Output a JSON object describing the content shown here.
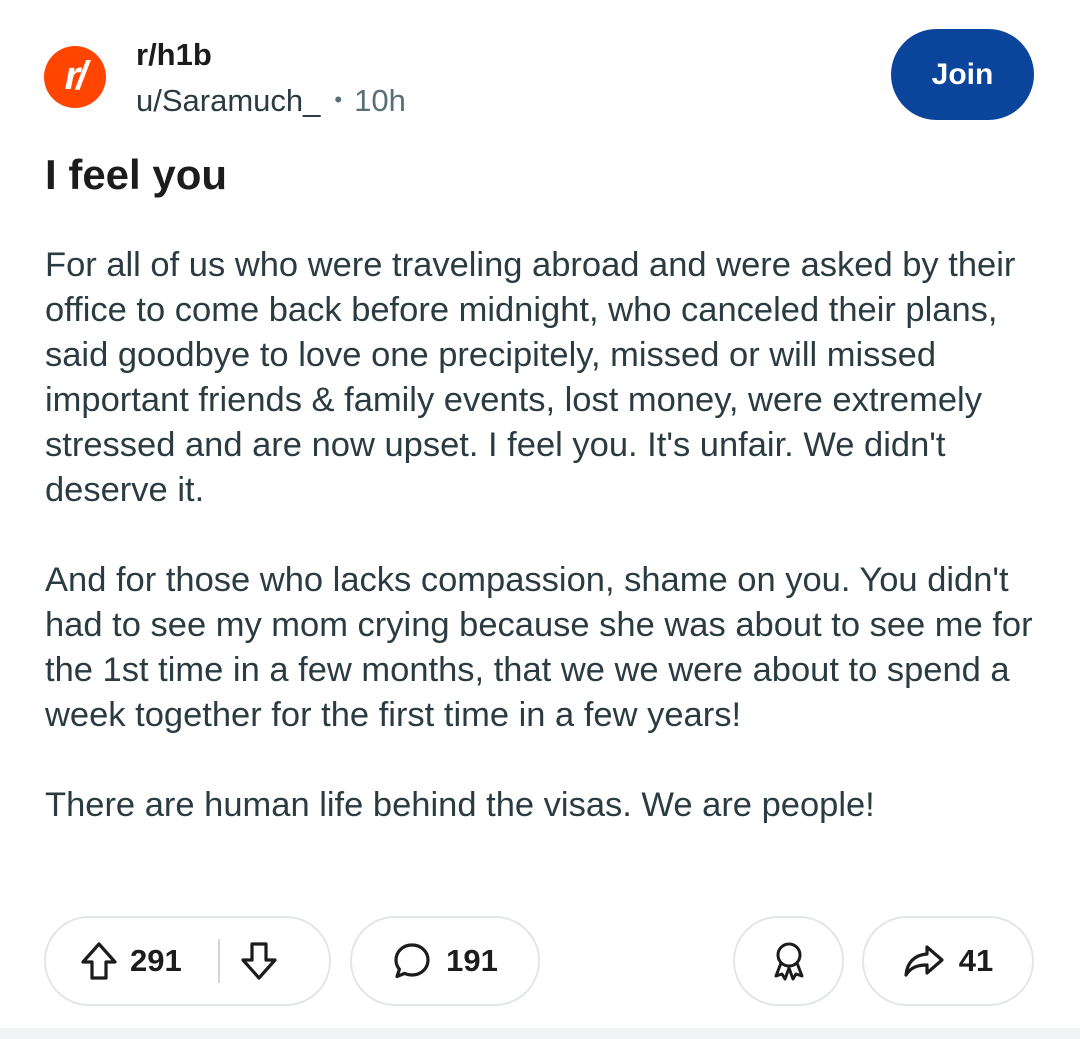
{
  "header": {
    "avatar_text": "r/",
    "subreddit": "r/h1b",
    "username": "u/Saramuch_",
    "separator": "•",
    "age": "10h",
    "join_label": "Join"
  },
  "post": {
    "title": "I feel you",
    "paragraphs": [
      "For all of us who were traveling abroad and were asked by their office to come back before midnight, who canceled their plans, said goodbye to love one precipitely, missed or will missed important friends & family events, lost money, were extremely stressed and are now upset. I feel you. It's unfair. We didn't deserve it.",
      "And for those who lacks compassion, shame on you. You didn't had to see my mom crying because she was about to see me for the 1st time in a few months, that we we were about to spend a week together for the first time in a few years!",
      "There are human life behind the visas. We are people!"
    ]
  },
  "actions": {
    "score": "291",
    "comments": "191",
    "shares": "41",
    "icons": {
      "upvote": "arrow-up-icon",
      "downvote": "arrow-down-icon",
      "comment": "speech-bubble-icon",
      "award": "award-ribbon-icon",
      "share": "share-arrow-icon"
    }
  },
  "colors": {
    "brand": "#ff4500",
    "join_button": "#0a449b",
    "text": "#1c1c1c",
    "body_text": "#2a3c42",
    "muted": "#576f76",
    "pill_border": "#e3e6e8"
  }
}
